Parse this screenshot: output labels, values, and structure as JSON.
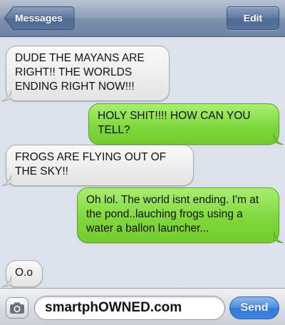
{
  "navbar": {
    "back_label": "Messages",
    "edit_label": "Edit"
  },
  "messages": [
    {
      "direction": "in",
      "text": "DUDE THE MAYANS ARE RIGHT!! THE WORLDS ENDING RIGHT NOW!!!"
    },
    {
      "direction": "out",
      "text": "HOLY SHIT!!!! HOW CAN YOU TELL?"
    },
    {
      "direction": "in",
      "text": "FROGS ARE FLYING OUT OF THE SKY!!"
    },
    {
      "direction": "out",
      "text": "Oh lol. The world isnt ending. I'm at the pond..lauching frogs using a water a ballon launcher..."
    },
    {
      "direction": "in",
      "text": "O.o"
    }
  ],
  "composer": {
    "text_value": "smartphOWNED.com",
    "send_label": "Send"
  },
  "icons": {
    "back": "back-arrow-icon",
    "camera": "camera-icon"
  },
  "colors": {
    "outgoing_bubble": "#7ed63b",
    "incoming_bubble": "#eeeeee",
    "send_button": "#3f84de",
    "navbar": "#8e9fb8"
  }
}
